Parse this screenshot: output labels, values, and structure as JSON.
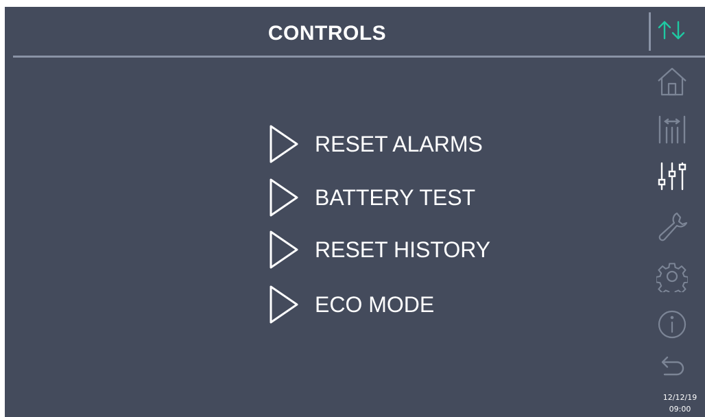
{
  "header": {
    "title": "CONTROLS",
    "status_icon": "communication-updown-icon"
  },
  "menu": {
    "items": [
      {
        "label": "RESET ALARMS",
        "icon": "play-arrow-icon"
      },
      {
        "label": "BATTERY TEST",
        "icon": "play-arrow-icon"
      },
      {
        "label": "RESET HISTORY",
        "icon": "play-arrow-icon"
      },
      {
        "label": "ECO MODE",
        "icon": "play-arrow-icon"
      }
    ]
  },
  "sidebar": {
    "items": [
      {
        "icon": "home-icon",
        "active": false
      },
      {
        "icon": "measurements-icon",
        "active": false
      },
      {
        "icon": "controls-sliders-icon",
        "active": true
      },
      {
        "icon": "wrench-icon",
        "active": false
      },
      {
        "icon": "gear-icon",
        "active": false
      },
      {
        "icon": "info-icon",
        "active": false
      },
      {
        "icon": "back-arrow-icon",
        "active": false
      }
    ]
  },
  "status": {
    "date": "12/12/19",
    "time": "09:00"
  },
  "colors": {
    "background": "#444b5c",
    "accent": "#1fc8a2",
    "inactive_icon": "#7c8596",
    "active_icon": "#ffffff"
  }
}
